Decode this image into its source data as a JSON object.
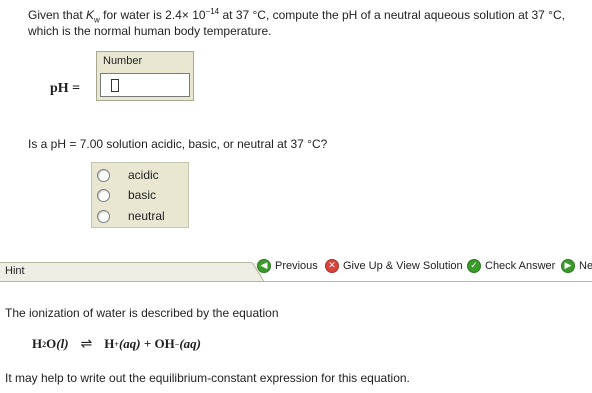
{
  "question1": {
    "prefix": "Given that ",
    "k": "K",
    "k_sub": "w",
    "middle": " for water is 2.4× 10",
    "exponent": "−14",
    "suffix": " at 37 °C, compute the pH of a neutral aqueous solution at 37 °C,",
    "line2": "which is the normal human body temperature."
  },
  "answer_field": {
    "box_label": "Number",
    "value": "",
    "prompt": "pH ="
  },
  "question2": {
    "text": "Is a pH = 7.00 solution acidic, basic, or neutral at 37 °C?",
    "options": [
      "acidic",
      "basic",
      "neutral"
    ]
  },
  "toolbar": {
    "previous": "Previous",
    "give_up": "Give Up & View Solution",
    "check_answer": "Check Answer",
    "next": "Ne"
  },
  "hint": {
    "tab_label": "Hint",
    "text1": "The ionization of water is described by the equation",
    "eq_h2o": "H",
    "eq_2": "2",
    "eq_o": "O",
    "eq_l": "(l)",
    "eq_h": "H",
    "eq_plus_sup": "+",
    "eq_aq1": "(aq)",
    "eq_plus": " + ",
    "eq_oh": "OH",
    "eq_minus_sup": "−",
    "eq_aq2": "(aq)",
    "text2": "It may help to write out the equilibrium-constant expression for this equation."
  }
}
